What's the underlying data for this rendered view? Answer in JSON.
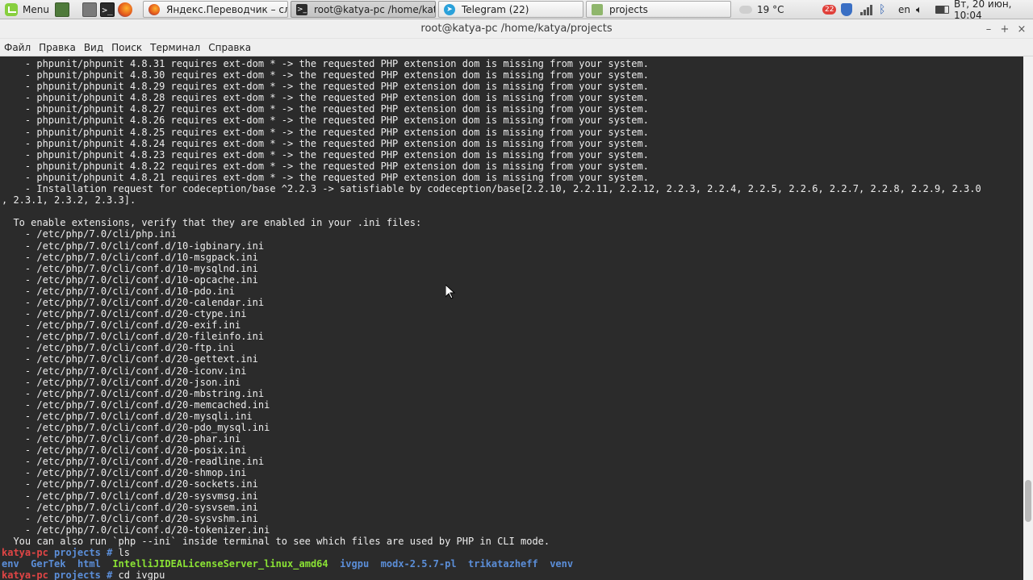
{
  "panel": {
    "menu_label": "Menu",
    "tasks": [
      {
        "label": "Яндекс.Переводчик – сл…",
        "icon": "firefox-icon",
        "active": false
      },
      {
        "label": "root@katya-pc /home/kat…",
        "icon": "terminal-icon",
        "active": true
      },
      {
        "label": "Telegram (22)",
        "icon": "telegram-icon",
        "active": false
      },
      {
        "label": "projects",
        "icon": "folder-icon",
        "active": false
      }
    ],
    "weather": "19 °C",
    "notification_count": "22",
    "keyboard_layout": "en",
    "clock": "Вт, 20 июн, 10:04"
  },
  "window": {
    "title": "root@katya-pc /home/katya/projects",
    "menu": [
      "Файл",
      "Правка",
      "Вид",
      "Поиск",
      "Терминал",
      "Справка"
    ]
  },
  "terminal": {
    "lines": [
      "    - phpunit/phpunit 4.8.31 requires ext-dom * -> the requested PHP extension dom is missing from your system.",
      "    - phpunit/phpunit 4.8.30 requires ext-dom * -> the requested PHP extension dom is missing from your system.",
      "    - phpunit/phpunit 4.8.29 requires ext-dom * -> the requested PHP extension dom is missing from your system.",
      "    - phpunit/phpunit 4.8.28 requires ext-dom * -> the requested PHP extension dom is missing from your system.",
      "    - phpunit/phpunit 4.8.27 requires ext-dom * -> the requested PHP extension dom is missing from your system.",
      "    - phpunit/phpunit 4.8.26 requires ext-dom * -> the requested PHP extension dom is missing from your system.",
      "    - phpunit/phpunit 4.8.25 requires ext-dom * -> the requested PHP extension dom is missing from your system.",
      "    - phpunit/phpunit 4.8.24 requires ext-dom * -> the requested PHP extension dom is missing from your system.",
      "    - phpunit/phpunit 4.8.23 requires ext-dom * -> the requested PHP extension dom is missing from your system.",
      "    - phpunit/phpunit 4.8.22 requires ext-dom * -> the requested PHP extension dom is missing from your system.",
      "    - phpunit/phpunit 4.8.21 requires ext-dom * -> the requested PHP extension dom is missing from your system.",
      "    - Installation request for codeception/base ^2.2.3 -> satisfiable by codeception/base[2.2.10, 2.2.11, 2.2.12, 2.2.3, 2.2.4, 2.2.5, 2.2.6, 2.2.7, 2.2.8, 2.2.9, 2.3.0",
      ", 2.3.1, 2.3.2, 2.3.3].",
      "",
      "  To enable extensions, verify that they are enabled in your .ini files:",
      "    - /etc/php/7.0/cli/php.ini",
      "    - /etc/php/7.0/cli/conf.d/10-igbinary.ini",
      "    - /etc/php/7.0/cli/conf.d/10-msgpack.ini",
      "    - /etc/php/7.0/cli/conf.d/10-mysqlnd.ini",
      "    - /etc/php/7.0/cli/conf.d/10-opcache.ini",
      "    - /etc/php/7.0/cli/conf.d/10-pdo.ini",
      "    - /etc/php/7.0/cli/conf.d/20-calendar.ini",
      "    - /etc/php/7.0/cli/conf.d/20-ctype.ini",
      "    - /etc/php/7.0/cli/conf.d/20-exif.ini",
      "    - /etc/php/7.0/cli/conf.d/20-fileinfo.ini",
      "    - /etc/php/7.0/cli/conf.d/20-ftp.ini",
      "    - /etc/php/7.0/cli/conf.d/20-gettext.ini",
      "    - /etc/php/7.0/cli/conf.d/20-iconv.ini",
      "    - /etc/php/7.0/cli/conf.d/20-json.ini",
      "    - /etc/php/7.0/cli/conf.d/20-mbstring.ini",
      "    - /etc/php/7.0/cli/conf.d/20-memcached.ini",
      "    - /etc/php/7.0/cli/conf.d/20-mysqli.ini",
      "    - /etc/php/7.0/cli/conf.d/20-pdo_mysql.ini",
      "    - /etc/php/7.0/cli/conf.d/20-phar.ini",
      "    - /etc/php/7.0/cli/conf.d/20-posix.ini",
      "    - /etc/php/7.0/cli/conf.d/20-readline.ini",
      "    - /etc/php/7.0/cli/conf.d/20-shmop.ini",
      "    - /etc/php/7.0/cli/conf.d/20-sockets.ini",
      "    - /etc/php/7.0/cli/conf.d/20-sysvmsg.ini",
      "    - /etc/php/7.0/cli/conf.d/20-sysvsem.ini",
      "    - /etc/php/7.0/cli/conf.d/20-sysvshm.ini",
      "    - /etc/php/7.0/cli/conf.d/20-tokenizer.ini",
      "  You can also run `php --ini` inside terminal to see which files are used by PHP in CLI mode."
    ],
    "prompt_host": "katya-pc",
    "prompt_dir": "projects",
    "prompt_symbol": "#",
    "command_1": "ls",
    "ls_output": [
      {
        "name": "env",
        "color": "blue"
      },
      {
        "name": "GerTek",
        "color": "blue"
      },
      {
        "name": "html",
        "color": "blue"
      },
      {
        "name": "IntelliJIDEALicenseServer_linux_amd64",
        "color": "green"
      },
      {
        "name": "ivgpu",
        "color": "blue"
      },
      {
        "name": "modx-2.5.7-pl",
        "color": "blue"
      },
      {
        "name": "trikatazheff",
        "color": "blue"
      },
      {
        "name": "venv",
        "color": "blue"
      }
    ],
    "command_2": "cd ivgpu"
  },
  "scrollbar": {
    "position": 0.88,
    "visible_fraction": 0.08
  }
}
